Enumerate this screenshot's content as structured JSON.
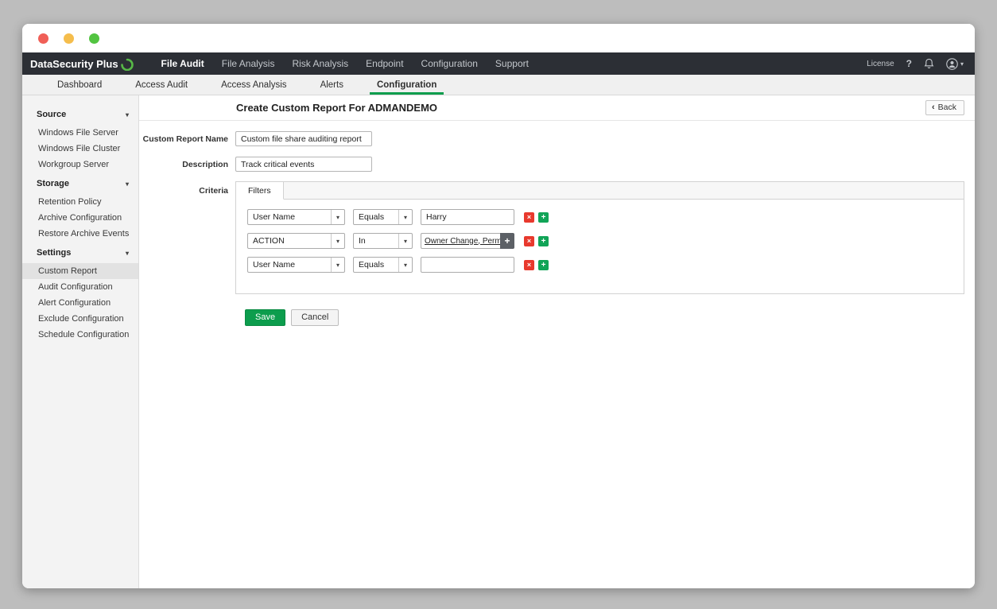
{
  "navbar": {
    "brand": "DataSecurity Plus",
    "items": [
      {
        "label": "File Audit"
      },
      {
        "label": "File Analysis"
      },
      {
        "label": "Risk Analysis"
      },
      {
        "label": "Endpoint"
      },
      {
        "label": "Configuration"
      },
      {
        "label": "Support"
      }
    ],
    "license": "License",
    "help": "?"
  },
  "tabs": [
    {
      "label": "Dashboard"
    },
    {
      "label": "Access Audit"
    },
    {
      "label": "Access Analysis"
    },
    {
      "label": "Alerts"
    },
    {
      "label": "Configuration"
    }
  ],
  "sidebar": {
    "sections": [
      {
        "title": "Source",
        "items": [
          {
            "label": "Windows File Server"
          },
          {
            "label": "Windows File Cluster"
          },
          {
            "label": "Workgroup Server"
          }
        ]
      },
      {
        "title": "Storage",
        "items": [
          {
            "label": "Retention Policy"
          },
          {
            "label": "Archive Configuration"
          },
          {
            "label": "Restore Archive Events"
          }
        ]
      },
      {
        "title": "Settings",
        "items": [
          {
            "label": "Custom Report"
          },
          {
            "label": "Audit Configuration"
          },
          {
            "label": "Alert Configuration"
          },
          {
            "label": "Exclude Configuration"
          },
          {
            "label": "Schedule Configuration"
          }
        ]
      }
    ]
  },
  "main": {
    "title": "Create Custom Report For ADMANDEMO",
    "back_label": "Back",
    "form": {
      "name_label": "Custom Report Name",
      "name_value": "Custom file share auditing report",
      "description_label": "Description",
      "description_value": "Track critical events",
      "criteria_label": "Criteria",
      "filters_tab": "Filters",
      "rows": [
        {
          "field": "User Name",
          "operator": "Equals",
          "value": "Harry"
        },
        {
          "field": "ACTION",
          "operator": "In",
          "value": "Owner Change, Permis..."
        },
        {
          "field": "User Name",
          "operator": "Equals",
          "value": ""
        }
      ],
      "save_label": "Save",
      "cancel_label": "Cancel"
    }
  },
  "icons": {
    "caret_down": "▾",
    "select_caret": "▾",
    "back_chevron": "‹",
    "delete": "×",
    "add": "+",
    "picker_add": "+",
    "user_caret": "▾"
  },
  "colors": {
    "accent_green": "#0c9d4d",
    "navbar_bg": "#2c2f35",
    "danger_red": "#e8392d"
  }
}
